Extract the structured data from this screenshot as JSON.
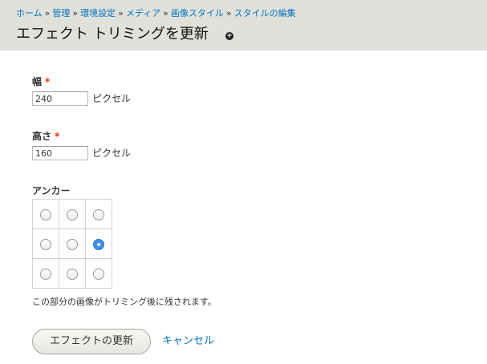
{
  "breadcrumb": {
    "items": [
      "ホーム",
      "管理",
      "環境設定",
      "メディア",
      "画像スタイル",
      "スタイルの編集"
    ],
    "separator": "»"
  },
  "page_title": "エフェクト トリミングを更新",
  "shortcut_icon": "add-shortcut-icon",
  "form": {
    "width": {
      "label": "幅",
      "required_mark": "*",
      "value": "240",
      "suffix": "ピクセル"
    },
    "height": {
      "label": "高さ",
      "required_mark": "*",
      "value": "160",
      "suffix": "ピクセル"
    },
    "anchor": {
      "label": "アンカー",
      "options": [
        [
          "left-top",
          "center-top",
          "right-top"
        ],
        [
          "left-center",
          "center-center",
          "right-center"
        ],
        [
          "left-bottom",
          "center-bottom",
          "right-bottom"
        ]
      ],
      "selected": "right-center",
      "description": "この部分の画像がトリミング後に残されます。"
    }
  },
  "actions": {
    "submit_label": "エフェクトの更新",
    "cancel_label": "キャンセル"
  },
  "colors": {
    "header_bg": "#e1e1dc",
    "link": "#0074bd",
    "required": "#e32700",
    "radio_checked": "#3d8ee6"
  }
}
